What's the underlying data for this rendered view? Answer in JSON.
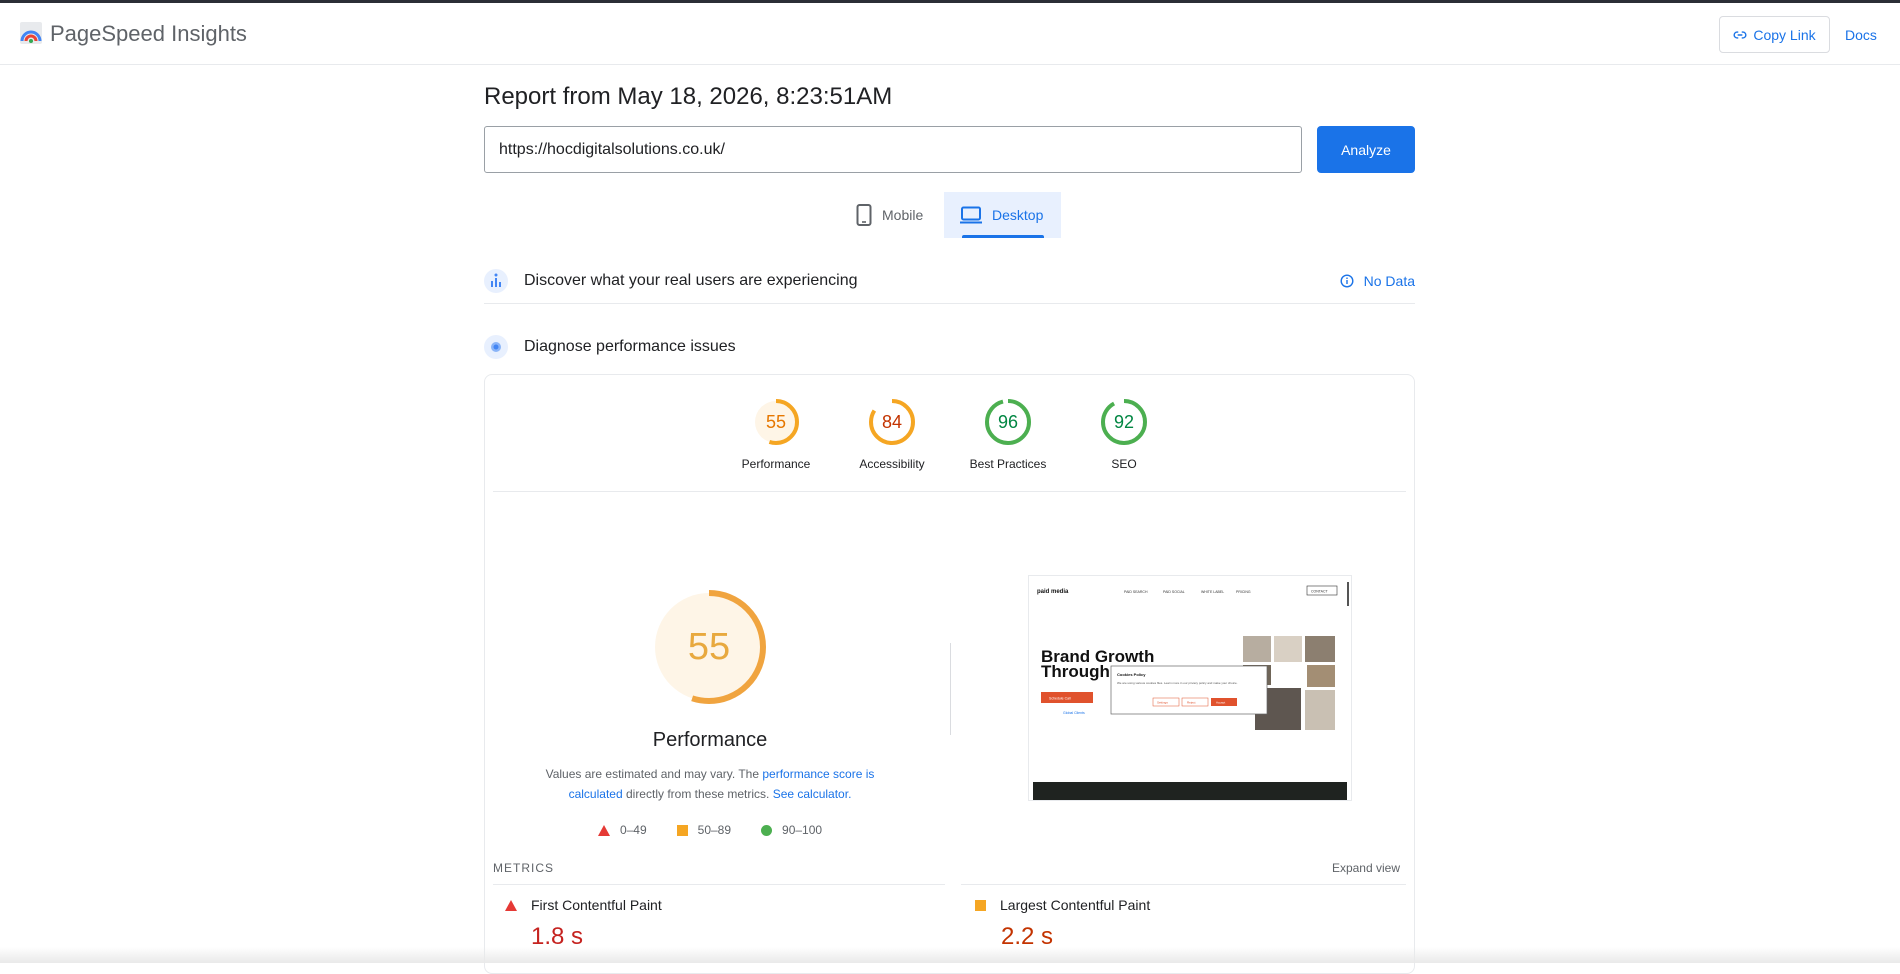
{
  "header": {
    "brand": "PageSpeed Insights",
    "copy_link": "Copy Link",
    "docs": "Docs"
  },
  "report": {
    "title": "Report from May 18, 2026, 8:23:51AM",
    "url": "https://hocdigitalsolutions.co.uk/",
    "analyze": "Analyze"
  },
  "tabs": {
    "mobile": "Mobile",
    "desktop": "Desktop",
    "active": "desktop"
  },
  "field_data": {
    "title": "Discover what your real users are experiencing",
    "status": "No Data"
  },
  "lab": {
    "title": "Diagnose performance issues"
  },
  "scores": [
    {
      "label": "Performance",
      "value": 55,
      "color": "#e67700",
      "fill": "#fef5e7",
      "stroke": "#f5a623"
    },
    {
      "label": "Accessibility",
      "value": 84,
      "color": "#c33300",
      "fill": "#ffffff",
      "stroke": "#f5a623"
    },
    {
      "label": "Best Practices",
      "value": 96,
      "color": "#018642",
      "fill": "#ffffff",
      "stroke": "#4caf50"
    },
    {
      "label": "SEO",
      "value": 92,
      "color": "#018642",
      "fill": "#ffffff",
      "stroke": "#4caf50"
    }
  ],
  "performance": {
    "score": 55,
    "title": "Performance",
    "desc_1": "Values are estimated and may vary. The ",
    "desc_link_1": "performance score is calculated",
    "desc_2": " directly from these metrics. ",
    "desc_link_2": "See calculator.",
    "legend": [
      "0–49",
      "50–89",
      "90–100"
    ]
  },
  "screenshot": {
    "brand": "paid media",
    "nav": [
      "PAID SEARCH",
      "PAID SOCIAL",
      "WHITE LABEL",
      "PRICING"
    ],
    "contact": "CONTACT",
    "headline_1": "Brand Growth",
    "headline_2": "Through",
    "cookie_title": "Cookies Policy",
    "cookie_text": "We are using various cookies files. Learn more in our privacy policy and make your choice.",
    "cookie_buttons": [
      "Settings",
      "Reject",
      "Accept"
    ],
    "cta": "Schedule Call",
    "trust": "Global Clients"
  },
  "metrics": {
    "heading": "METRICS",
    "expand": "Expand view",
    "items": [
      {
        "name": "First Contentful Paint",
        "value": "1.8 s",
        "rating": "poor"
      },
      {
        "name": "Largest Contentful Paint",
        "value": "2.2 s",
        "rating": "average"
      }
    ]
  }
}
